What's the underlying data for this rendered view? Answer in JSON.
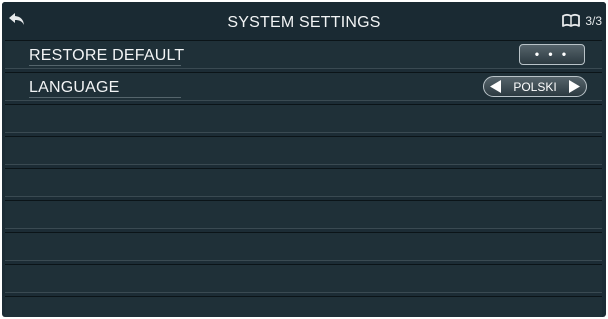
{
  "header": {
    "title": "SYSTEM SETTINGS",
    "back_icon": "back-arrow-icon",
    "page_icon": "book-icon",
    "page_indicator": "3/3"
  },
  "settings": {
    "restore_default": {
      "label": "RESTORE DEFAULT",
      "button_label": "• • •"
    },
    "language": {
      "label": "LANGUAGE",
      "value": "POLSKI",
      "prev_icon": "arrow-left-icon",
      "next_icon": "arrow-right-icon"
    }
  },
  "empty_rows": 7,
  "colors": {
    "background": "#1c2c35",
    "text": "#f2f4f5"
  }
}
